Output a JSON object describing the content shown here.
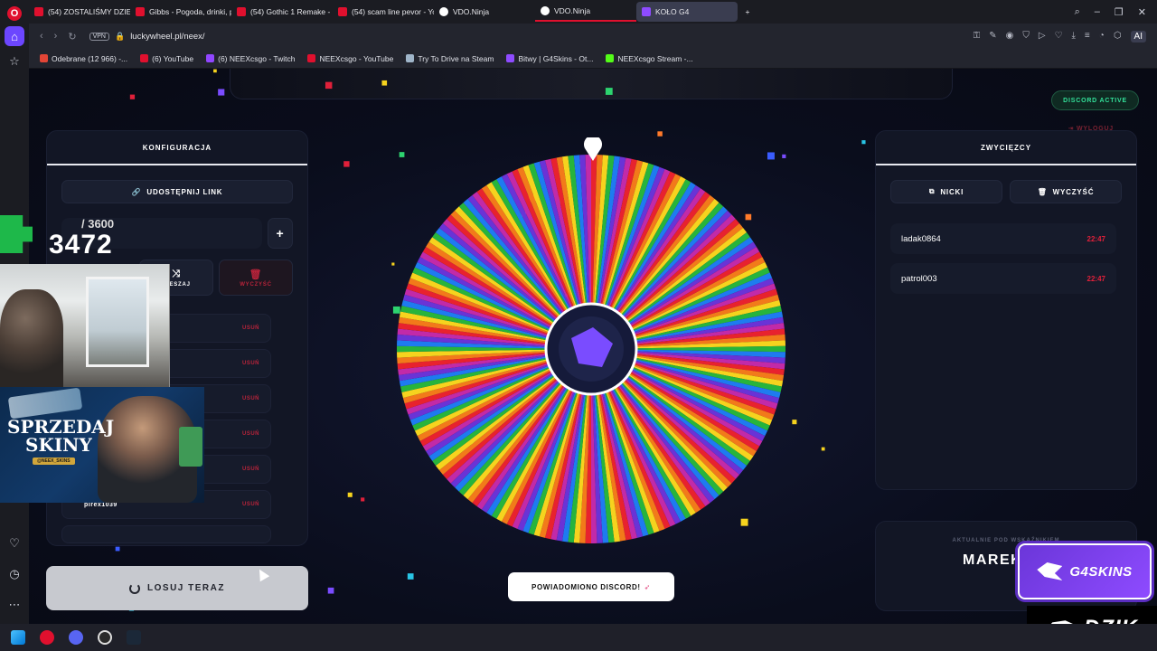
{
  "browser": {
    "tabs": [
      {
        "label": "(54) ZOSTALIŚMY DZIENN",
        "color": "#e0102e"
      },
      {
        "label": "Gibbs - Pogoda, drinki, pla",
        "color": "#e0102e"
      },
      {
        "label": "(54) Gothic 1 Remake - M",
        "color": "#e0102e"
      },
      {
        "label": "(54) scam line pevor - You",
        "color": "#e0102e"
      },
      {
        "label": "VDO.Ninja",
        "color": "#ffffff"
      },
      {
        "label": "VDO.Ninja",
        "color": "#ffffff"
      },
      {
        "label": "KOŁO G4",
        "color": "#8e4bff"
      }
    ],
    "url": "luckywheel.pl/neex/",
    "vpn": "VPN",
    "ai_label": "AI",
    "bookmarks": [
      {
        "label": "Odebrane (12 966) -...",
        "color": "#ffffff"
      },
      {
        "label": "(6) YouTube",
        "color": "#e0102e"
      },
      {
        "label": "(6) NEEXcsgo - Twitch",
        "color": "#9146ff"
      },
      {
        "label": "NEEXcsgo - YouTube",
        "color": "#e0102e"
      },
      {
        "label": "Try To Drive na Steam",
        "color": "#1b2838"
      },
      {
        "label": "Bitwy | G4Skins - Ot...",
        "color": "#8e4bff"
      },
      {
        "label": "NEEXcsgo Stream -...",
        "color": "#53fc18"
      }
    ]
  },
  "page": {
    "discord_active": "DISCORD ACTIVE",
    "logout": "WYLOGUJ",
    "config": {
      "title": "KONFIGURACJA",
      "share_link": "UDOSTĘPNIJ LINK",
      "add_button": "+",
      "shuffle": "MIESZAJ",
      "clear": "WYCZYŚĆ",
      "remove_label": "USUŃ",
      "visible_entry": "pirex1039",
      "rows_count": 7
    },
    "winners": {
      "title": "ZWYCIĘZCY",
      "nicks_button": "NICKI",
      "clear_button": "WYCZYŚĆ",
      "entries": [
        {
          "name": "ladak0864",
          "time": "22:47"
        },
        {
          "name": "patrol003",
          "time": "22:47"
        }
      ]
    },
    "current": {
      "label": "AKTUALNIE POD WSKAŹNIKIEM",
      "name": "MAREK"
    },
    "draw_button": "LOSUJ TERAZ",
    "toast": "POWIADOMIONO DISCORD!",
    "wheel_colors": [
      "#e8222e",
      "#f27a1a",
      "#f6d31e",
      "#27b43c",
      "#1e7bf0",
      "#6a33d6",
      "#c22aa8"
    ]
  },
  "overlay": {
    "counter_total": "/ 3600",
    "counter_value": "3472",
    "ad_line1": "SPRZEDAJ",
    "ad_line2": "SKINY",
    "ad_brand": "@NEEX_SKINS",
    "sponsor1": "G4SKINS",
    "sponsor2": "DZIK"
  }
}
